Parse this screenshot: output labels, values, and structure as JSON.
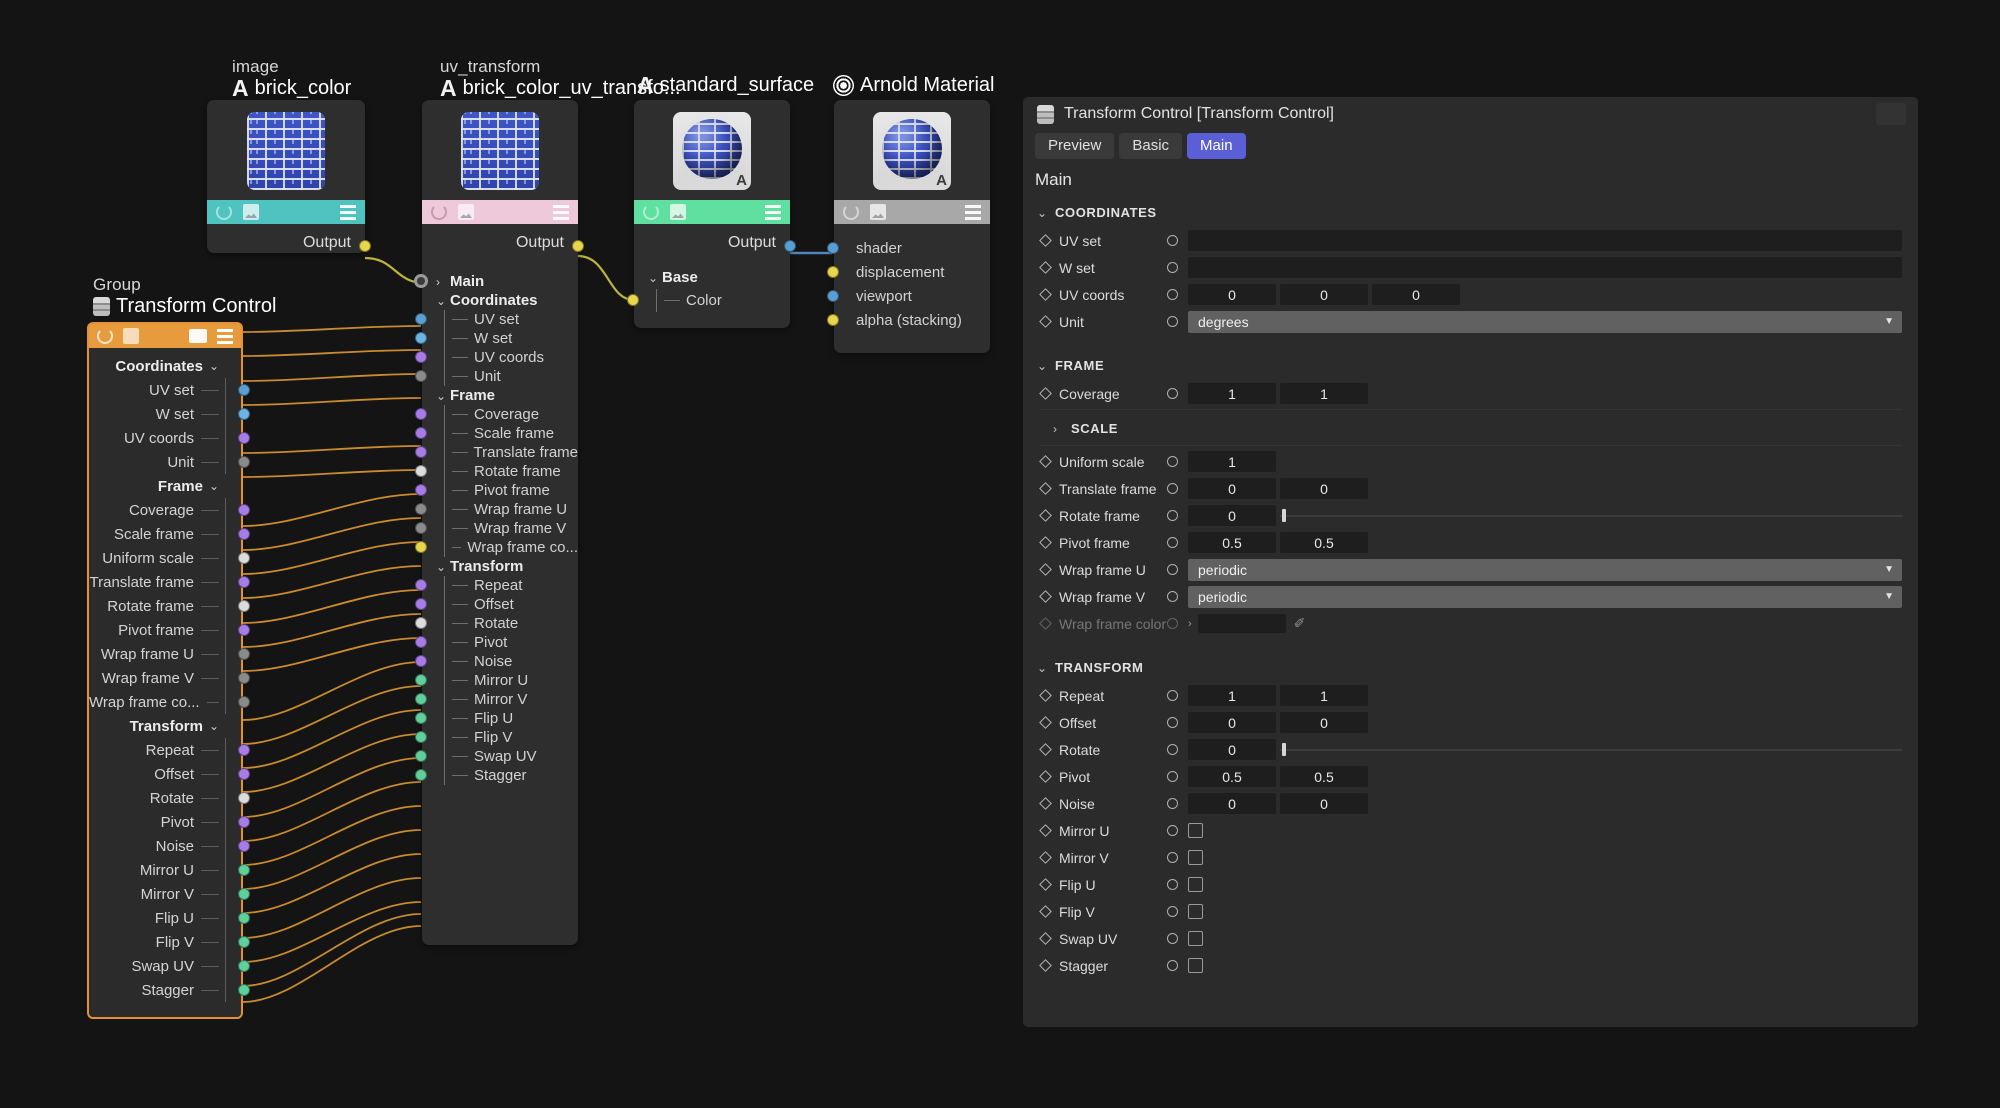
{
  "graph": {
    "nodes": {
      "image_node": {
        "type": "image",
        "name": "brick_color",
        "output_label": "Output",
        "bar_color": "#4ec3bf"
      },
      "uv_node": {
        "type": "uv_transform",
        "name": "brick_color_uv_transfo...",
        "output_label": "Output",
        "bar_color": "#edc9d9"
      },
      "surface_node": {
        "type": "",
        "name": "standard_surface",
        "output_label": "Output",
        "bar_color": "#5fe0a0"
      },
      "material_node": {
        "type": "",
        "name": "Arnold Material",
        "bar_color": "#a8a8a8"
      },
      "group_node": {
        "type": "Group",
        "name": "Transform Control",
        "bar_color": "#e89b3c"
      }
    },
    "uv_tree": [
      {
        "label": "Main",
        "kind": "group",
        "port": "hollow"
      },
      {
        "label": "Coordinates",
        "kind": "group",
        "port": "none"
      },
      {
        "label": "UV set",
        "kind": "leaf",
        "port": "blue"
      },
      {
        "label": "W set",
        "kind": "leaf",
        "port": "bluel"
      },
      {
        "label": "UV coords",
        "kind": "leaf",
        "port": "purple"
      },
      {
        "label": "Unit",
        "kind": "leaf",
        "port": "gray"
      },
      {
        "label": "Frame",
        "kind": "group",
        "port": "none"
      },
      {
        "label": "Coverage",
        "kind": "leaf",
        "port": "purple"
      },
      {
        "label": "Scale frame",
        "kind": "leaf",
        "port": "purple"
      },
      {
        "label": "Translate frame",
        "kind": "leaf",
        "port": "purple"
      },
      {
        "label": "Rotate frame",
        "kind": "leaf",
        "port": "white"
      },
      {
        "label": "Pivot frame",
        "kind": "leaf",
        "port": "purple"
      },
      {
        "label": "Wrap frame U",
        "kind": "leaf",
        "port": "gray"
      },
      {
        "label": "Wrap frame V",
        "kind": "leaf",
        "port": "gray"
      },
      {
        "label": "Wrap frame co...",
        "kind": "leaf",
        "port": "yellow"
      },
      {
        "label": "Transform",
        "kind": "group",
        "port": "none"
      },
      {
        "label": "Repeat",
        "kind": "leaf",
        "port": "purple"
      },
      {
        "label": "Offset",
        "kind": "leaf",
        "port": "purple"
      },
      {
        "label": "Rotate",
        "kind": "leaf",
        "port": "white"
      },
      {
        "label": "Pivot",
        "kind": "leaf",
        "port": "purple"
      },
      {
        "label": "Noise",
        "kind": "leaf",
        "port": "purple"
      },
      {
        "label": "Mirror U",
        "kind": "leaf",
        "port": "green"
      },
      {
        "label": "Mirror V",
        "kind": "leaf",
        "port": "green"
      },
      {
        "label": "Flip U",
        "kind": "leaf",
        "port": "green"
      },
      {
        "label": "Flip V",
        "kind": "leaf",
        "port": "green"
      },
      {
        "label": "Swap UV",
        "kind": "leaf",
        "port": "green"
      },
      {
        "label": "Stagger",
        "kind": "leaf",
        "port": "green"
      }
    ],
    "group_rows": [
      {
        "label": "Coordinates",
        "kind": "group",
        "port": "none"
      },
      {
        "label": "UV set",
        "kind": "leaf",
        "port": "blue"
      },
      {
        "label": "W set",
        "kind": "leaf",
        "port": "bluel"
      },
      {
        "label": "UV coords",
        "kind": "leaf",
        "port": "purple"
      },
      {
        "label": "Unit",
        "kind": "leaf",
        "port": "gray"
      },
      {
        "label": "Frame",
        "kind": "group",
        "port": "none"
      },
      {
        "label": "Coverage",
        "kind": "leaf",
        "port": "purple"
      },
      {
        "label": "Scale frame",
        "kind": "leaf",
        "port": "purple"
      },
      {
        "label": "Uniform scale",
        "kind": "leaf",
        "port": "white"
      },
      {
        "label": "Translate frame",
        "kind": "leaf",
        "port": "purple"
      },
      {
        "label": "Rotate frame",
        "kind": "leaf",
        "port": "white"
      },
      {
        "label": "Pivot frame",
        "kind": "leaf",
        "port": "purple"
      },
      {
        "label": "Wrap frame U",
        "kind": "leaf",
        "port": "gray"
      },
      {
        "label": "Wrap frame V",
        "kind": "leaf",
        "port": "gray"
      },
      {
        "label": "Wrap frame co...",
        "kind": "leaf",
        "port": "gray"
      },
      {
        "label": "Transform",
        "kind": "group",
        "port": "none"
      },
      {
        "label": "Repeat",
        "kind": "leaf",
        "port": "purple"
      },
      {
        "label": "Offset",
        "kind": "leaf",
        "port": "purple"
      },
      {
        "label": "Rotate",
        "kind": "leaf",
        "port": "white"
      },
      {
        "label": "Pivot",
        "kind": "leaf",
        "port": "purple"
      },
      {
        "label": "Noise",
        "kind": "leaf",
        "port": "purple"
      },
      {
        "label": "Mirror U",
        "kind": "leaf",
        "port": "green"
      },
      {
        "label": "Mirror V",
        "kind": "leaf",
        "port": "green"
      },
      {
        "label": "Flip U",
        "kind": "leaf",
        "port": "green"
      },
      {
        "label": "Flip V",
        "kind": "leaf",
        "port": "green"
      },
      {
        "label": "Swap UV",
        "kind": "leaf",
        "port": "green"
      },
      {
        "label": "Stagger",
        "kind": "leaf",
        "port": "green"
      }
    ],
    "surface_inputs": [
      {
        "label": "Base",
        "kind": "group",
        "port": "none"
      },
      {
        "label": "Color",
        "kind": "leaf",
        "port": "yellow"
      }
    ],
    "material_inputs": [
      {
        "label": "shader",
        "port": "blue"
      },
      {
        "label": "displacement",
        "port": "yellow"
      },
      {
        "label": "viewport",
        "port": "blue"
      },
      {
        "label": "alpha (stacking)",
        "port": "yellow"
      }
    ]
  },
  "panel": {
    "title": "Transform Control [Transform Control]",
    "tabs": [
      {
        "label": "Preview",
        "active": false
      },
      {
        "label": "Basic",
        "active": false
      },
      {
        "label": "Main",
        "active": true
      }
    ],
    "section_title": "Main",
    "accent_color": "#5b5fd6",
    "sections": [
      {
        "name": "COORDINATES",
        "collapsed": false,
        "rows": [
          {
            "label": "UV set",
            "type": "text",
            "values": [
              ""
            ]
          },
          {
            "label": "W set",
            "type": "text",
            "values": [
              ""
            ]
          },
          {
            "label": "UV coords",
            "type": "num3",
            "values": [
              "0",
              "0",
              "0"
            ]
          },
          {
            "label": "Unit",
            "type": "combo",
            "values": [
              "degrees"
            ]
          }
        ]
      },
      {
        "name": "FRAME",
        "collapsed": false,
        "rows": [
          {
            "label": "Coverage",
            "type": "num2",
            "values": [
              "1",
              "1"
            ]
          }
        ],
        "subsections": [
          {
            "name": "SCALE",
            "collapsed": true,
            "rows": [
              {
                "label": "Uniform scale",
                "type": "num1",
                "values": [
                  "1"
                ]
              },
              {
                "label": "Translate frame",
                "type": "num2",
                "values": [
                  "0",
                  "0"
                ]
              },
              {
                "label": "Rotate frame",
                "type": "slider",
                "values": [
                  "0"
                ]
              },
              {
                "label": "Pivot frame",
                "type": "num2",
                "values": [
                  "0.5",
                  "0.5"
                ]
              },
              {
                "label": "Wrap frame U",
                "type": "combo",
                "values": [
                  "periodic"
                ]
              },
              {
                "label": "Wrap frame V",
                "type": "combo",
                "values": [
                  "periodic"
                ]
              },
              {
                "label": "Wrap frame color",
                "type": "color",
                "values": [
                  ""
                ],
                "disabled": true
              }
            ]
          }
        ]
      },
      {
        "name": "TRANSFORM",
        "collapsed": false,
        "rows": [
          {
            "label": "Repeat",
            "type": "num2",
            "values": [
              "1",
              "1"
            ]
          },
          {
            "label": "Offset",
            "type": "num2",
            "values": [
              "0",
              "0"
            ]
          },
          {
            "label": "Rotate",
            "type": "slider",
            "values": [
              "0"
            ]
          },
          {
            "label": "Pivot",
            "type": "num2",
            "values": [
              "0.5",
              "0.5"
            ]
          },
          {
            "label": "Noise",
            "type": "num2",
            "values": [
              "0",
              "0"
            ]
          },
          {
            "label": "Mirror U",
            "type": "check",
            "values": [
              false
            ]
          },
          {
            "label": "Mirror V",
            "type": "check",
            "values": [
              false
            ]
          },
          {
            "label": "Flip U",
            "type": "check",
            "values": [
              false
            ]
          },
          {
            "label": "Flip V",
            "type": "check",
            "values": [
              false
            ]
          },
          {
            "label": "Swap UV",
            "type": "check",
            "values": [
              false
            ]
          },
          {
            "label": "Stagger",
            "type": "check",
            "values": [
              false
            ]
          }
        ]
      }
    ]
  }
}
